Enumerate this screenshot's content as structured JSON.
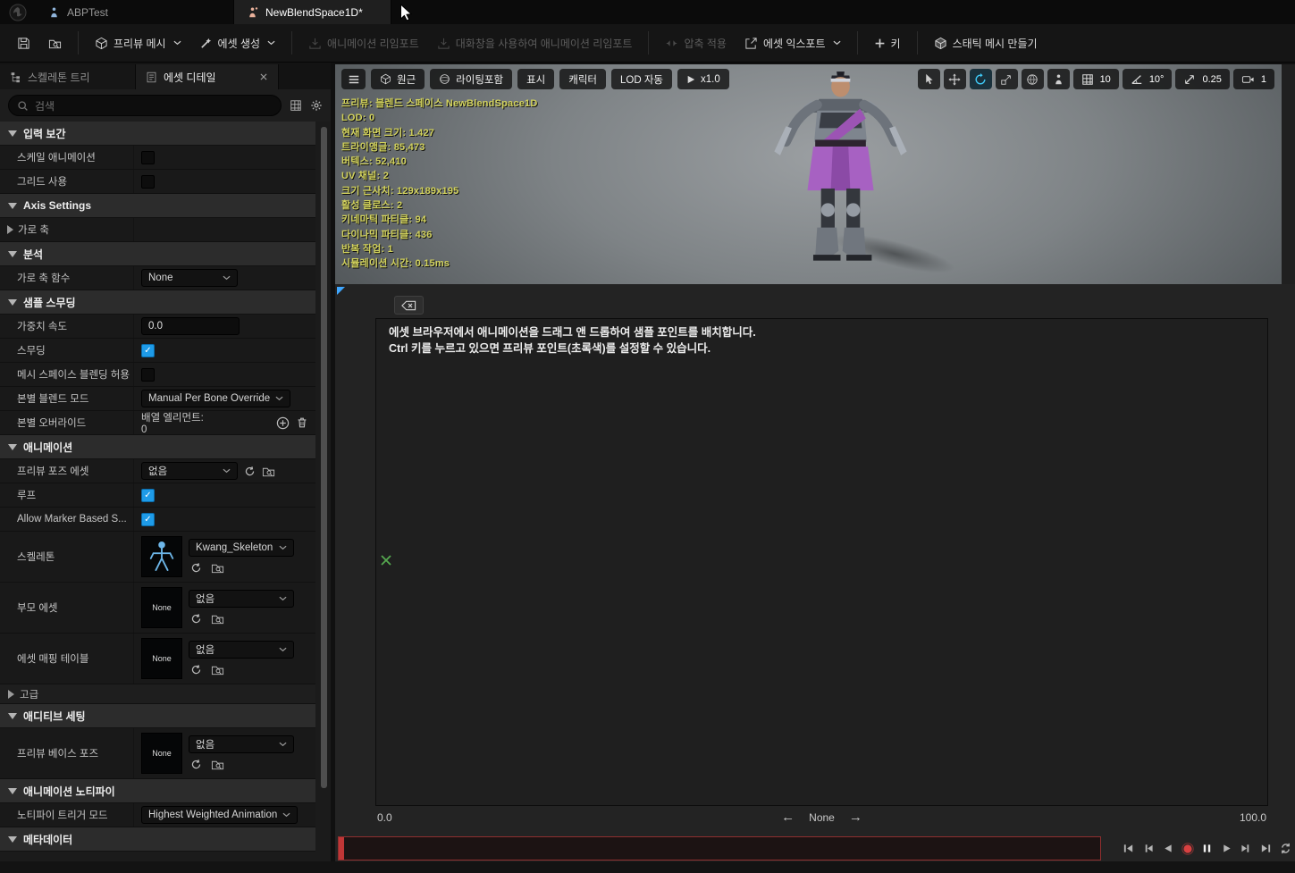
{
  "colors": {
    "accent": "#1e9be8",
    "stats_text": "#d2d25c",
    "record": "#d84040",
    "marker_green": "#55a84f",
    "timeline_border": "#8f2f2f"
  },
  "window_tabs": [
    {
      "label": "ABPTest",
      "icon": "blueprint-asset",
      "active": false
    },
    {
      "label": "NewBlendSpace1D*",
      "icon": "blendspace-asset",
      "active": true
    }
  ],
  "toolbar": {
    "items": [
      {
        "name": "save-button",
        "icon": "save"
      },
      {
        "name": "browse-button",
        "icon": "browse"
      },
      {
        "name": "preview-mesh-button",
        "icon": "mesh",
        "label": "프리뷰 메시",
        "dropdown": true,
        "sep_before": true
      },
      {
        "name": "create-asset-button",
        "icon": "wand",
        "label": "에셋 생성",
        "dropdown": true
      },
      {
        "name": "reimport-animation-button",
        "icon": "import",
        "label": "애니메이션 리임포트",
        "disabled": true,
        "sep_before": true
      },
      {
        "name": "reimport-animation-dialog-button",
        "icon": "import",
        "label": "대화창을 사용하여 애니메이션 리임포트",
        "disabled": true
      },
      {
        "name": "apply-compression-button",
        "icon": "compress",
        "label": "압축 적용",
        "disabled": true,
        "sep_before": true
      },
      {
        "name": "export-asset-button",
        "icon": "export",
        "label": "에셋 익스포트",
        "dropdown": true
      },
      {
        "name": "add-key-button",
        "icon": "plus",
        "label": "키",
        "sep_before": true
      },
      {
        "name": "make-static-mesh-button",
        "icon": "staticmesh",
        "label": "스태틱 메시 만들기",
        "sep_before": true
      }
    ]
  },
  "left_panel": {
    "tabs": [
      {
        "label": "스켈레톤 트리",
        "icon": "tree",
        "active": false
      },
      {
        "label": "에셋 디테일",
        "icon": "detail",
        "active": true,
        "closable": true
      }
    ],
    "search_placeholder": "검색",
    "rows": [
      {
        "type": "section",
        "label": "입력 보간"
      },
      {
        "type": "prop",
        "label": "스케일 애니메이션",
        "control": "checkbox",
        "checked": false
      },
      {
        "type": "prop",
        "label": "그리드 사용",
        "control": "checkbox",
        "checked": false
      },
      {
        "type": "section",
        "label": "Axis Settings"
      },
      {
        "type": "prop-expand",
        "label": "가로 축"
      },
      {
        "type": "section",
        "label": "분석"
      },
      {
        "type": "prop",
        "label": "가로 축 함수",
        "control": "dropdown",
        "value": "None"
      },
      {
        "type": "section",
        "label": "샘플 스무딩"
      },
      {
        "type": "prop",
        "label": "가중치 속도",
        "control": "input",
        "value": "0.0"
      },
      {
        "type": "prop",
        "label": "스무딩",
        "control": "checkbox",
        "checked": true
      },
      {
        "type": "prop",
        "label": "메시 스페이스 블렌딩 허용",
        "control": "checkbox",
        "checked": false
      },
      {
        "type": "prop",
        "label": "본별 블렌드 모드",
        "control": "dropdown",
        "value": "Manual Per Bone Override"
      },
      {
        "type": "prop",
        "label": "본별 오버라이드",
        "control": "array",
        "value": "배열 엘리먼트: 0"
      },
      {
        "type": "section",
        "label": "애니메이션"
      },
      {
        "type": "prop",
        "label": "프리뷰 포즈 에셋",
        "control": "dropdown-asset",
        "value": "없음"
      },
      {
        "type": "prop",
        "label": "루프",
        "control": "checkbox",
        "checked": true
      },
      {
        "type": "prop",
        "label": "Allow Marker Based S...",
        "control": "checkbox",
        "checked": true
      },
      {
        "type": "asset",
        "label": "스켈레톤",
        "value": "Kwang_Skeleton",
        "thumb": "skeleton",
        "reset": true
      },
      {
        "type": "asset",
        "label": "부모 에셋",
        "value": "없음",
        "thumb": "None"
      },
      {
        "type": "asset",
        "label": "에셋 매핑 테이블",
        "value": "없음",
        "thumb": "None"
      },
      {
        "type": "advanced",
        "label": "고급"
      },
      {
        "type": "section",
        "label": "애디티브 세팅"
      },
      {
        "type": "asset",
        "label": "프리뷰 베이스 포즈",
        "value": "없음",
        "thumb": "None"
      },
      {
        "type": "section",
        "label": "애니메이션 노티파이"
      },
      {
        "type": "prop",
        "label": "노티파이 트리거 모드",
        "control": "dropdown",
        "value": "Highest Weighted Animation"
      },
      {
        "type": "section",
        "label": "메타데이터"
      }
    ]
  },
  "viewport": {
    "menu_pills": [
      {
        "name": "perspective-menu",
        "label": "원근",
        "icon": "cube"
      },
      {
        "name": "view-mode-menu",
        "label": "라이팅포함",
        "icon": "sphere"
      },
      {
        "name": "show-menu",
        "label": "표시"
      },
      {
        "name": "character-menu",
        "label": "캐릭터"
      },
      {
        "name": "lod-menu",
        "label": "LOD 자동"
      },
      {
        "name": "play-speed-menu",
        "label": "x1.0",
        "icon": "playsm"
      }
    ],
    "tools": [
      {
        "name": "select-tool",
        "icon": "cursor"
      },
      {
        "name": "translate-tool",
        "icon": "move"
      },
      {
        "name": "rotate-tool",
        "icon": "rotate",
        "active": true
      },
      {
        "name": "scale-tool",
        "icon": "scale"
      },
      {
        "name": "coordinate-space-toggle",
        "icon": "globe"
      },
      {
        "name": "character-toggle",
        "icon": "person"
      }
    ],
    "snaps": [
      {
        "name": "grid-snap",
        "icon": "gridsnap",
        "value": "10"
      },
      {
        "name": "rotation-snap",
        "icon": "angle",
        "value": "10°"
      },
      {
        "name": "scale-snap",
        "icon": "diag",
        "value": "0.25"
      },
      {
        "name": "camera-speed",
        "icon": "camera",
        "value": "1"
      }
    ],
    "stats": [
      "프리뷰: 블렌드 스페이스 NewBlendSpace1D",
      "LOD: 0",
      "현재 화면 크기: 1.427",
      "트라이앵글: 85,473",
      "버텍스: 52,410",
      "UV 채널: 2",
      "크기 근사치: 129x189x195",
      "활성 클로스: 2",
      "키네마틱 파티클: 94",
      "다이나믹 파티클: 436",
      "반복 작업: 1",
      "시뮬레이션 시간: 0.15ms"
    ]
  },
  "blendspace": {
    "hint_line1": "에셋 브라우저에서 애니메이션을 드래그 앤 드롭하여 샘플 포인트를 배치합니다.",
    "hint_line2": "Ctrl 키를 누르고 있으면 프리뷰 포인트(초록색)를 설정할 수 있습니다.",
    "axis_min": "0.0",
    "axis_max": "100.0",
    "axis_label": "None"
  },
  "playback": {
    "buttons": [
      {
        "name": "go-to-front",
        "icon": "tostart"
      },
      {
        "name": "step-backward",
        "icon": "stepback"
      },
      {
        "name": "play-reverse",
        "icon": "playrev"
      },
      {
        "name": "record",
        "icon": "record"
      },
      {
        "name": "pause",
        "icon": "pause",
        "active": true
      },
      {
        "name": "play-forward",
        "icon": "play"
      },
      {
        "name": "step-forward",
        "icon": "stepfwd"
      },
      {
        "name": "go-to-end",
        "icon": "toend"
      },
      {
        "name": "toggle-loop",
        "icon": "loop"
      }
    ]
  }
}
